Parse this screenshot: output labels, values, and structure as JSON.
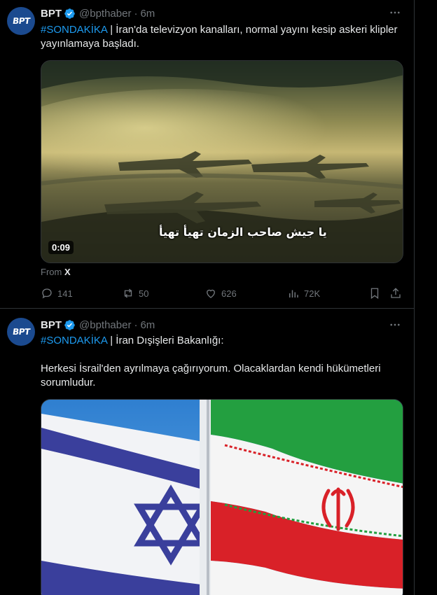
{
  "colors": {
    "background": "#000000",
    "text": "#e7e9ea",
    "muted": "#71767b",
    "accent": "#1d9bf0"
  },
  "tweets": [
    {
      "name": "BPT",
      "handle": "@bpthaber",
      "separator": "·",
      "time": "6m",
      "avatar_text": "BPT",
      "hashtag": "#SONDAKİKA",
      "text_line": " | İran'da televizyon kanalları, normal yayını kesip askeri klipler yayınlamaya başladı.",
      "video": {
        "duration": "0:09",
        "caption": "يا جيش صاحب الزمان تهيأ تهيأ"
      },
      "from_label": "From",
      "from_source": "X",
      "replies": "141",
      "reposts": "50",
      "likes": "626",
      "views": "72K"
    },
    {
      "name": "BPT",
      "handle": "@bpthaber",
      "separator": "·",
      "time": "6m",
      "avatar_text": "BPT",
      "hashtag": "#SONDAKİKA",
      "text_line": " | İran Dışişleri Bakanlığı:",
      "text_para": "Herkesi İsrail'den ayrılmaya çağırıyorum. Olacaklardan kendi hükümetleri sorumludur."
    }
  ]
}
